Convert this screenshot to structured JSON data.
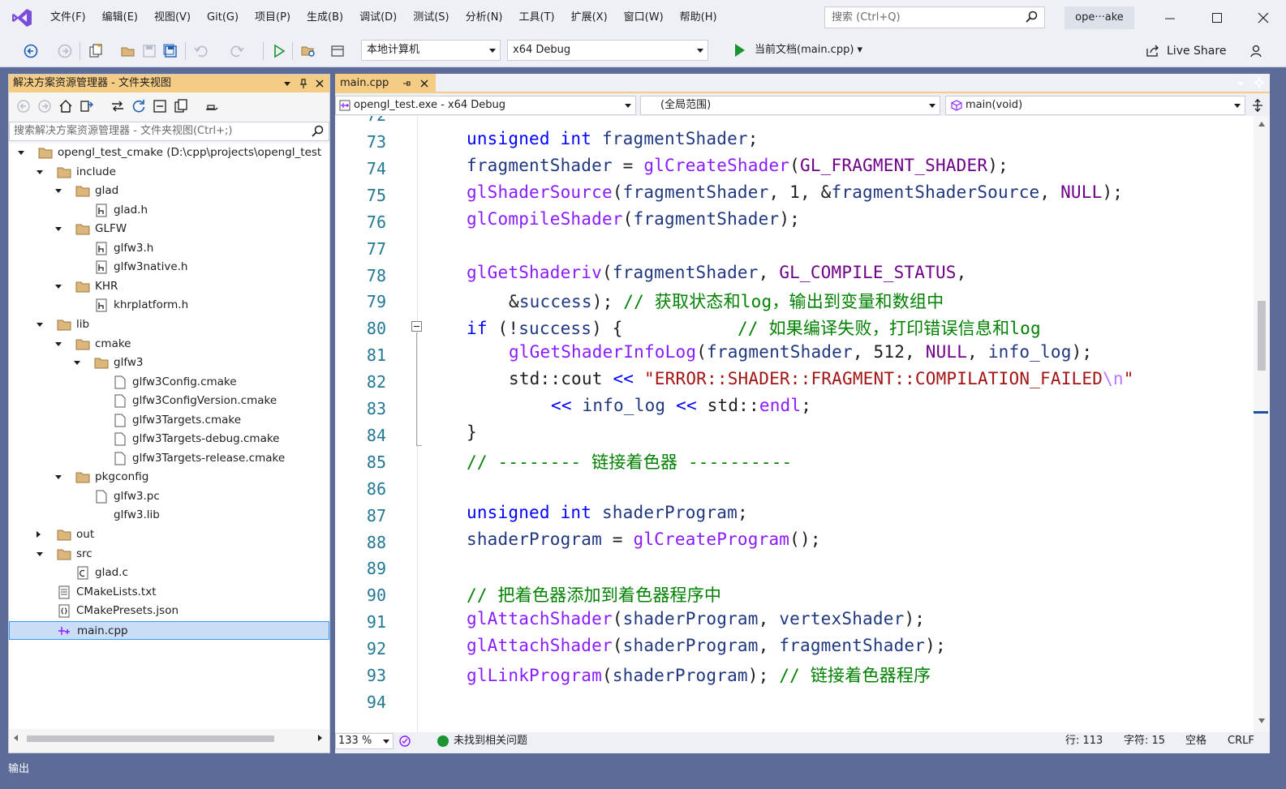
{
  "menu": [
    "文件(F)",
    "编辑(E)",
    "视图(V)",
    "Git(G)",
    "项目(P)",
    "生成(B)",
    "调试(D)",
    "测试(S)",
    "分析(N)",
    "工具(T)",
    "扩展(X)",
    "窗口(W)",
    "帮助(H)"
  ],
  "search": {
    "placeholder": "搜索 (Ctrl+Q)"
  },
  "solution_name": "ope···ake",
  "toolbar": {
    "target_machine": "本地计算机",
    "config": "x64 Debug",
    "run_label": "当前文档(main.cpp)",
    "live_share": "Live Share"
  },
  "explorer": {
    "title": "解决方案资源管理器 - 文件夹视图",
    "search_placeholder": "搜索解决方案资源管理器 - 文件夹视图(Ctrl+;)",
    "tree": [
      {
        "label": "opengl_test_cmake (D:\\cpp\\projects\\opengl_test",
        "depth": 0,
        "toggle": "open",
        "icon": "folder"
      },
      {
        "label": "include",
        "depth": 1,
        "toggle": "open",
        "icon": "folder"
      },
      {
        "label": "glad",
        "depth": 2,
        "toggle": "open",
        "icon": "folder"
      },
      {
        "label": "glad.h",
        "depth": 3,
        "toggle": "none",
        "icon": "header"
      },
      {
        "label": "GLFW",
        "depth": 2,
        "toggle": "open",
        "icon": "folder"
      },
      {
        "label": "glfw3.h",
        "depth": 3,
        "toggle": "none",
        "icon": "header"
      },
      {
        "label": "glfw3native.h",
        "depth": 3,
        "toggle": "none",
        "icon": "header"
      },
      {
        "label": "KHR",
        "depth": 2,
        "toggle": "open",
        "icon": "folder"
      },
      {
        "label": "khrplatform.h",
        "depth": 3,
        "toggle": "none",
        "icon": "header"
      },
      {
        "label": "lib",
        "depth": 1,
        "toggle": "open",
        "icon": "folder"
      },
      {
        "label": "cmake",
        "depth": 2,
        "toggle": "open",
        "icon": "folder"
      },
      {
        "label": "glfw3",
        "depth": 3,
        "toggle": "open",
        "icon": "folder"
      },
      {
        "label": "glfw3Config.cmake",
        "depth": 4,
        "toggle": "none",
        "icon": "file"
      },
      {
        "label": "glfw3ConfigVersion.cmake",
        "depth": 4,
        "toggle": "none",
        "icon": "file"
      },
      {
        "label": "glfw3Targets.cmake",
        "depth": 4,
        "toggle": "none",
        "icon": "file"
      },
      {
        "label": "glfw3Targets-debug.cmake",
        "depth": 4,
        "toggle": "none",
        "icon": "file"
      },
      {
        "label": "glfw3Targets-release.cmake",
        "depth": 4,
        "toggle": "none",
        "icon": "file"
      },
      {
        "label": "pkgconfig",
        "depth": 2,
        "toggle": "open",
        "icon": "folder"
      },
      {
        "label": "glfw3.pc",
        "depth": 3,
        "toggle": "none",
        "icon": "file"
      },
      {
        "label": "glfw3.lib",
        "depth": 3,
        "toggle": "none",
        "icon": "none"
      },
      {
        "label": "out",
        "depth": 1,
        "toggle": "closed",
        "icon": "folder"
      },
      {
        "label": "src",
        "depth": 1,
        "toggle": "open",
        "icon": "folder"
      },
      {
        "label": "glad.c",
        "depth": 2,
        "toggle": "none",
        "icon": "csource"
      },
      {
        "label": "CMakeLists.txt",
        "depth": 1,
        "toggle": "none",
        "icon": "text"
      },
      {
        "label": "CMakePresets.json",
        "depth": 1,
        "toggle": "none",
        "icon": "json"
      },
      {
        "label": "main.cpp",
        "depth": 1,
        "toggle": "none",
        "icon": "cpp",
        "selected": true
      }
    ]
  },
  "editor": {
    "tab": "main.cpp",
    "nav_project": "opengl_test.exe - x64 Debug",
    "nav_scope": "(全局范围)",
    "nav_member": "main(void)",
    "partial_top_line": "72",
    "lines": [
      {
        "n": "73",
        "indent": 0,
        "parts": [
          [
            "kw",
            "unsigned "
          ],
          [
            "kw",
            "int "
          ],
          [
            "var",
            "fragmentShader"
          ],
          [
            "",
            "; "
          ]
        ]
      },
      {
        "n": "74",
        "indent": 0,
        "parts": [
          [
            "var",
            "fragmentShader"
          ],
          [
            "",
            " = "
          ],
          [
            "fn",
            "glCreateShader"
          ],
          [
            "",
            "("
          ],
          [
            "mac",
            "GL_FRAGMENT_SHADER"
          ],
          [
            "",
            ");"
          ]
        ]
      },
      {
        "n": "75",
        "indent": 0,
        "parts": [
          [
            "fn",
            "glShaderSource"
          ],
          [
            "",
            "("
          ],
          [
            "var",
            "fragmentShader"
          ],
          [
            "",
            ", 1, &"
          ],
          [
            "var",
            "fragmentShaderSource"
          ],
          [
            "",
            ", "
          ],
          [
            "mac",
            "NULL"
          ],
          [
            "",
            ");"
          ]
        ]
      },
      {
        "n": "76",
        "indent": 0,
        "parts": [
          [
            "fn",
            "glCompileShader"
          ],
          [
            "",
            "("
          ],
          [
            "var",
            "fragmentShader"
          ],
          [
            "",
            ");"
          ]
        ]
      },
      {
        "n": "77",
        "indent": 0,
        "parts": []
      },
      {
        "n": "78",
        "indent": 0,
        "parts": [
          [
            "fn",
            "glGetShaderiv"
          ],
          [
            "",
            "("
          ],
          [
            "var",
            "fragmentShader"
          ],
          [
            "",
            ", "
          ],
          [
            "mac",
            "GL_COMPILE_STATUS"
          ],
          [
            "",
            ","
          ]
        ]
      },
      {
        "n": "79",
        "indent": 2,
        "parts": [
          [
            "",
            "&"
          ],
          [
            "var",
            "success"
          ],
          [
            "",
            "); "
          ],
          [
            "cm",
            "// 获取状态和log，输出到变量和数组中"
          ]
        ]
      },
      {
        "n": "80",
        "indent": 0,
        "parts": [
          [
            "kw",
            "if"
          ],
          [
            "",
            " (!"
          ],
          [
            "var",
            "success"
          ],
          [
            "",
            ") {           "
          ],
          [
            "cm",
            "// 如果编译失败，打印错误信息和log"
          ]
        ]
      },
      {
        "n": "81",
        "indent": 2,
        "parts": [
          [
            "fn",
            "glGetShaderInfoLog"
          ],
          [
            "",
            "("
          ],
          [
            "var",
            "fragmentShader"
          ],
          [
            "",
            ", 512, "
          ],
          [
            "mac",
            "NULL"
          ],
          [
            "",
            ", "
          ],
          [
            "var",
            "info_log"
          ],
          [
            "",
            ");"
          ]
        ]
      },
      {
        "n": "82",
        "indent": 2,
        "parts": [
          [
            "",
            "std::cout "
          ],
          [
            "kw",
            "<<"
          ],
          [
            "",
            " "
          ],
          [
            "str",
            "\"ERROR::SHADER::FRAGMENT::COMPILATION_FAILED"
          ],
          [
            "esc",
            "\\n"
          ],
          [
            "str",
            "\""
          ]
        ]
      },
      {
        "n": "83",
        "indent": 4,
        "parts": [
          [
            "kw",
            "<<"
          ],
          [
            "",
            " "
          ],
          [
            "var",
            "info_log"
          ],
          [
            "",
            " "
          ],
          [
            "kw",
            "<<"
          ],
          [
            "",
            " std::"
          ],
          [
            "fn",
            "endl"
          ],
          [
            "",
            ";"
          ]
        ]
      },
      {
        "n": "84",
        "indent": 0,
        "parts": [
          [
            "",
            "}"
          ]
        ]
      },
      {
        "n": "85",
        "indent": 0,
        "parts": [
          [
            "cm",
            "// -------- 链接着色器 ----------"
          ]
        ]
      },
      {
        "n": "86",
        "indent": 0,
        "parts": []
      },
      {
        "n": "87",
        "indent": 0,
        "parts": [
          [
            "kw",
            "unsigned "
          ],
          [
            "kw",
            "int "
          ],
          [
            "var",
            "shaderProgram"
          ],
          [
            "",
            ";"
          ]
        ]
      },
      {
        "n": "88",
        "indent": 0,
        "parts": [
          [
            "var",
            "shaderProgram"
          ],
          [
            "",
            " = "
          ],
          [
            "fn",
            "glCreateProgram"
          ],
          [
            "",
            "();"
          ]
        ]
      },
      {
        "n": "89",
        "indent": 0,
        "parts": []
      },
      {
        "n": "90",
        "indent": 0,
        "parts": [
          [
            "cm",
            "// 把着色器添加到着色器程序中"
          ]
        ]
      },
      {
        "n": "91",
        "indent": 0,
        "parts": [
          [
            "fn",
            "glAttachShader"
          ],
          [
            "",
            "("
          ],
          [
            "var",
            "shaderProgram"
          ],
          [
            "",
            ", "
          ],
          [
            "var",
            "vertexShader"
          ],
          [
            "",
            ");"
          ]
        ]
      },
      {
        "n": "92",
        "indent": 0,
        "parts": [
          [
            "fn",
            "glAttachShader"
          ],
          [
            "",
            "("
          ],
          [
            "var",
            "shaderProgram"
          ],
          [
            "",
            ", "
          ],
          [
            "var",
            "fragmentShader"
          ],
          [
            "",
            ");"
          ]
        ]
      },
      {
        "n": "93",
        "indent": 0,
        "parts": [
          [
            "fn",
            "glLinkProgram"
          ],
          [
            "",
            "("
          ],
          [
            "var",
            "shaderProgram"
          ],
          [
            "",
            "); "
          ],
          [
            "cm",
            "// 链接着色器程序"
          ]
        ]
      },
      {
        "n": "94",
        "indent": 0,
        "parts": []
      }
    ]
  },
  "status": {
    "zoom": "133 %",
    "issues": "未找到相关问题",
    "line": "行: 113",
    "char": "字符: 15",
    "spaces": "空格",
    "eol": "CRLF"
  },
  "output": {
    "label": "输出"
  },
  "colors": {
    "accent": "#f5cc84",
    "chrome": "#5d6b99",
    "keyword": "#0000ff",
    "function": "#8a1bff",
    "comment": "#008000",
    "string": "#a31515"
  }
}
